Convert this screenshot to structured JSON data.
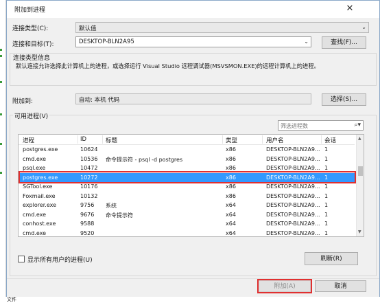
{
  "window": {
    "title": "附加到进程",
    "close_glyph": "✕"
  },
  "connection": {
    "type_label": "连接类型(C):",
    "type_value": "默认值",
    "target_label": "连接和目标(T):",
    "target_value": "DESKTOP-BLN2A95",
    "find_button": "查找(F)..."
  },
  "info": {
    "title": "连接类型信息",
    "text": "默认连接允许选择此计算机上的进程，或选择运行 Visual Studio 远程调试器(MSVSMON.EXE)的远程计算机上的进程。"
  },
  "attach": {
    "label": "附加到:",
    "value": "自动: 本机 代码",
    "select_button": "选择(S)..."
  },
  "processes": {
    "label": "可用进程(V)",
    "filter_placeholder": "筛选进程数",
    "columns": [
      "进程",
      "ID",
      "标题",
      "类型",
      "用户名",
      "会话"
    ],
    "rows": [
      {
        "process": "postgres.exe",
        "id": "10624",
        "title": "",
        "type": "x86",
        "user": "DESKTOP-BLN2A9...",
        "session": "1"
      },
      {
        "process": "cmd.exe",
        "id": "10536",
        "title": "命令提示符 - psql  -d postgres",
        "type": "x86",
        "user": "DESKTOP-BLN2A9...",
        "session": "1"
      },
      {
        "process": "psql.exe",
        "id": "10472",
        "title": "",
        "type": "x86",
        "user": "DESKTOP-BLN2A9...",
        "session": "1"
      },
      {
        "process": "postgres.exe",
        "id": "10272",
        "title": "",
        "type": "x86",
        "user": "DESKTOP-BLN2A9...",
        "session": "1"
      },
      {
        "process": "SGTool.exe",
        "id": "10176",
        "title": "",
        "type": "x86",
        "user": "DESKTOP-BLN2A9...",
        "session": "1"
      },
      {
        "process": "Foxmail.exe",
        "id": "10132",
        "title": "",
        "type": "x86",
        "user": "DESKTOP-BLN2A9...",
        "session": "1"
      },
      {
        "process": "explorer.exe",
        "id": "9756",
        "title": "系统",
        "type": "x64",
        "user": "DESKTOP-BLN2A9...",
        "session": "1"
      },
      {
        "process": "cmd.exe",
        "id": "9676",
        "title": "命令提示符",
        "type": "x64",
        "user": "DESKTOP-BLN2A9...",
        "session": "1"
      },
      {
        "process": "conhost.exe",
        "id": "9588",
        "title": "",
        "type": "x64",
        "user": "DESKTOP-BLN2A9...",
        "session": "1"
      },
      {
        "process": "cmd.exe",
        "id": "9520",
        "title": "",
        "type": "x64",
        "user": "DESKTOP-BLN2A9...",
        "session": "1"
      }
    ],
    "show_all_label": "显示所有用户的进程(U)",
    "refresh_button": "刷新(R)"
  },
  "footer": {
    "attach_button": "附加(A)",
    "cancel_button": "取消"
  },
  "taskbar_text": "文件",
  "colors": {
    "selection": "#3399ff",
    "highlight_border": "#e03030"
  }
}
